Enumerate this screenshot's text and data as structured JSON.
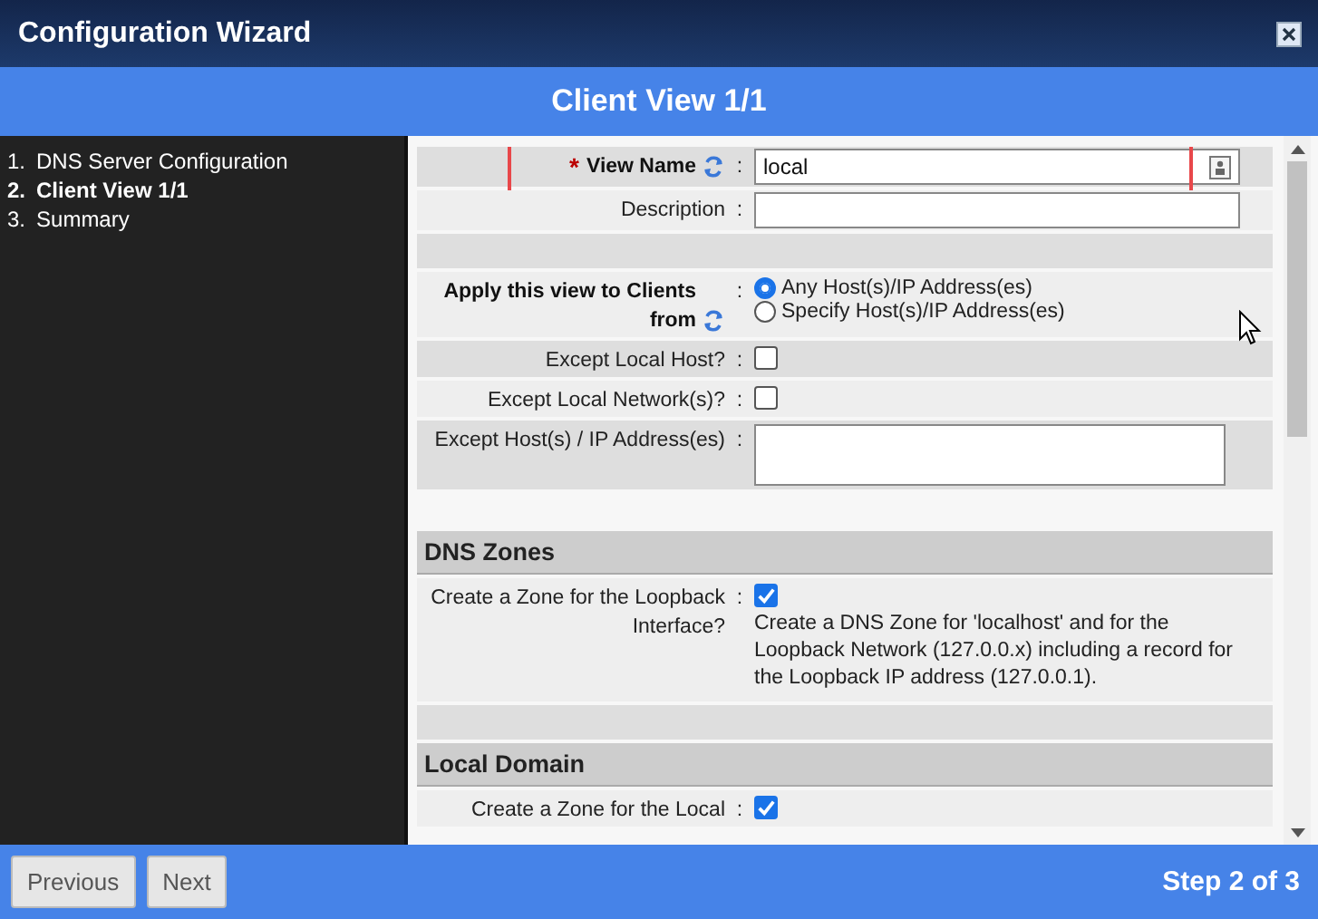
{
  "window": {
    "title": "Configuration Wizard"
  },
  "header": {
    "title": "Client View 1/1"
  },
  "steps": [
    {
      "number": "1.",
      "label": "DNS Server Configuration",
      "selected": false
    },
    {
      "number": "2.",
      "label": "Client View 1/1",
      "selected": true
    },
    {
      "number": "3.",
      "label": "Summary",
      "selected": false
    }
  ],
  "form": [
    {
      "kind": "text",
      "required_mark": "*",
      "label": "View Name",
      "bold": true,
      "refresh": true,
      "separator": ":",
      "value": "local",
      "shaded": true,
      "highlighted": true
    },
    {
      "kind": "text",
      "label": "Description",
      "bold": false,
      "refresh": false,
      "separator": ":",
      "shaded": false,
      "highlighted": false
    },
    {
      "kind": "spacer",
      "shaded": true
    },
    {
      "kind": "radio",
      "label": "Apply this view to Clients from",
      "bold": true,
      "refresh": true,
      "separator": ":",
      "shaded": false,
      "options": [
        {
          "label": "Any Host(s)/IP Address(es)",
          "selected": true
        },
        {
          "label": "Specify Host(s)/IP Address(es)",
          "selected": false
        }
      ]
    },
    {
      "kind": "checkbox",
      "label": "Except Local Host?",
      "separator": ":",
      "checked": false,
      "shaded": true
    },
    {
      "kind": "checkbox",
      "label": "Except Local Network(s)?",
      "separator": ":",
      "checked": false,
      "shaded": false
    },
    {
      "kind": "textarea",
      "label": "Except Host(s) / IP Address(es)",
      "separator": ":",
      "shaded": true
    },
    {
      "kind": "spacer"
    },
    {
      "kind": "section",
      "label": "DNS Zones"
    },
    {
      "kind": "checkbox",
      "label": "Create a Zone for the Loopback Interface?",
      "separator": ":",
      "checked": true,
      "shaded": false,
      "description": "Create a DNS Zone for 'localhost' and for the Loopback Network (127.0.0.x) including a record for the Loopback IP address (127.0.0.1)."
    },
    {
      "kind": "spacer",
      "shaded": true
    },
    {
      "kind": "section",
      "label": "Local Domain"
    },
    {
      "kind": "checkbox",
      "label": "Create a Zone for the Local",
      "separator": ":",
      "checked": true,
      "shaded": false
    }
  ],
  "footer": {
    "buttons": [
      "Previous",
      "Next"
    ],
    "step": "Step 2 of 3"
  }
}
